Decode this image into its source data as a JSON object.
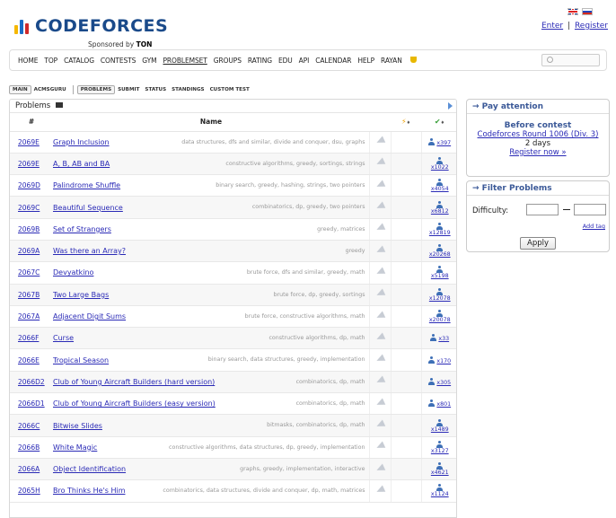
{
  "header": {
    "brand": "CODEFORCES",
    "sponsor_prefix": "Sponsored by",
    "sponsor_name": "TON",
    "enter_link": "Enter",
    "separator": "|",
    "register_link": "Register"
  },
  "menu": {
    "items": [
      "HOME",
      "TOP",
      "CATALOG",
      "CONTESTS",
      "GYM",
      "PROBLEMSET",
      "GROUPS",
      "RATING",
      "EDU",
      "API",
      "CALENDAR",
      "HELP",
      "RAYAN"
    ],
    "active": "PROBLEMSET"
  },
  "subtabs": {
    "left": [
      "MAIN",
      "ACMSGURU"
    ],
    "right": [
      "PROBLEMS",
      "SUBMIT",
      "STATUS",
      "STANDINGS",
      "CUSTOM TEST"
    ]
  },
  "problems": {
    "title": "Problems",
    "columns": {
      "id": "#",
      "name": "Name"
    },
    "rows": [
      {
        "id": "2069E",
        "name": "Graph Inclusion",
        "tags": "data structures, dfs and similar, divide and conquer, dsu, graphs",
        "solved": "x397"
      },
      {
        "id": "2069E",
        "name": "A, B, AB and BA",
        "tags": "constructive algorithms, greedy, sortings, strings",
        "solved": "x1022"
      },
      {
        "id": "2069D",
        "name": "Palindrome Shuffle",
        "tags": "binary search, greedy, hashing, strings, two pointers",
        "solved": "x4054"
      },
      {
        "id": "2069C",
        "name": "Beautiful Sequence",
        "tags": "combinatorics, dp, greedy, two pointers",
        "solved": "x6812"
      },
      {
        "id": "2069B",
        "name": "Set of Strangers",
        "tags": "greedy, matrices",
        "solved": "x12819"
      },
      {
        "id": "2069A",
        "name": "Was there an Array?",
        "tags": "greedy",
        "solved": "x20268"
      },
      {
        "id": "2067C",
        "name": "Devyatkino",
        "tags": "brute force, dfs and similar, greedy, math",
        "solved": "x5198"
      },
      {
        "id": "2067B",
        "name": "Two Large Bags",
        "tags": "brute force, dp, greedy, sortings",
        "solved": "x12078"
      },
      {
        "id": "2067A",
        "name": "Adjacent Digit Sums",
        "tags": "brute force, constructive algorithms, math",
        "solved": "x20078"
      },
      {
        "id": "2066F",
        "name": "Curse",
        "tags": "constructive algorithms, dp, math",
        "solved": "x33"
      },
      {
        "id": "2066E",
        "name": "Tropical Season",
        "tags": "binary search, data structures, greedy, implementation",
        "solved": "x170"
      },
      {
        "id": "2066D2",
        "name": "Club of Young Aircraft Builders (hard version)",
        "tags": "combinatorics, dp, math",
        "solved": "x305"
      },
      {
        "id": "2066D1",
        "name": "Club of Young Aircraft Builders (easy version)",
        "tags": "combinatorics, dp, math",
        "solved": "x801"
      },
      {
        "id": "2066C",
        "name": "Bitwise Slides",
        "tags": "bitmasks, combinatorics, dp, math",
        "solved": "x1489"
      },
      {
        "id": "2066B",
        "name": "White Magic",
        "tags": "constructive algorithms, data structures, dp, greedy, implementation",
        "solved": "x3127"
      },
      {
        "id": "2066A",
        "name": "Object Identification",
        "tags": "graphs, greedy, implementation, interactive",
        "solved": "x4621"
      },
      {
        "id": "2065H",
        "name": "Bro Thinks He's Him",
        "tags": "combinatorics, data structures, divide and conquer, dp, math, matrices",
        "solved": "x1124"
      }
    ]
  },
  "sidebar": {
    "pay_attention": {
      "caption": "→ Pay attention",
      "before": "Before contest",
      "contest_link": "Codeforces Round 1006 (Div. 3)",
      "days": "2 days",
      "register": "Register now »"
    },
    "filter": {
      "caption": "→ Filter Problems",
      "difficulty_label": "Difficulty:",
      "add_tag": "Add tag",
      "apply": "Apply"
    }
  },
  "colors": {
    "link": "#2a2ab6",
    "accent": "#3b5998",
    "logo_yellow": "#f5b700",
    "logo_blue": "#1a6cc6",
    "logo_red": "#d02a2a"
  }
}
